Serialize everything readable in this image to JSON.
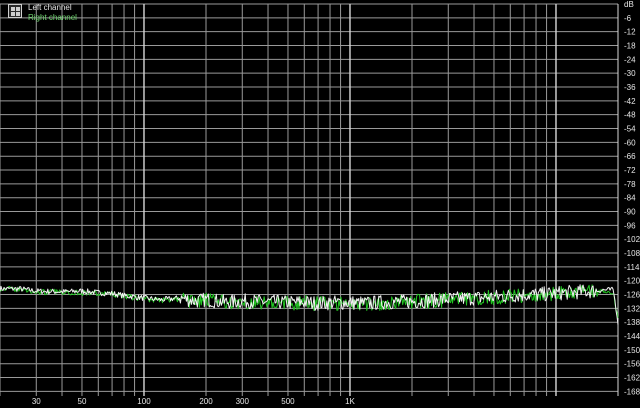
{
  "legend": {
    "left_label": "Left channel",
    "right_label": "Right channel",
    "icon": "grid-settings-icon"
  },
  "colors": {
    "background": "#000000",
    "grid_minor": "#9a9a9a",
    "grid_major": "#d8d8d8",
    "axis_text": "#e6e6e6",
    "left_channel": "#f2f2f2",
    "right_channel": "#22c722"
  },
  "chart_data": {
    "type": "line",
    "title": "",
    "xlabel": "",
    "ylabel": "dB",
    "x_scale": "log",
    "xlim": [
      20,
      20000
    ],
    "ylim": [
      -170,
      0
    ],
    "grid": true,
    "legend_placement": "top-left",
    "x_ticks": [
      {
        "value": 30,
        "label": "30"
      },
      {
        "value": 50,
        "label": "50"
      },
      {
        "value": 100,
        "label": "100"
      },
      {
        "value": 200,
        "label": "200"
      },
      {
        "value": 300,
        "label": "300"
      },
      {
        "value": 500,
        "label": "500"
      },
      {
        "value": 1000,
        "label": "1K"
      }
    ],
    "y_ticks": [
      0,
      -6,
      -12,
      -18,
      -24,
      -30,
      -36,
      -42,
      -48,
      -54,
      -60,
      -66,
      -72,
      -78,
      -84,
      -90,
      -96,
      -102,
      -108,
      -114,
      -120,
      -126,
      -132,
      -138,
      -144,
      -150,
      -156,
      -162,
      -168
    ],
    "y_tick_labels": [
      "dB",
      "-6",
      "-12",
      "-18",
      "-24",
      "-30",
      "-36",
      "-42",
      "-48",
      "-54",
      "-60",
      "-66",
      "-72",
      "-78",
      "-84",
      "-90",
      "-96",
      "-102",
      "-108",
      "-114",
      "-120",
      "-126",
      "-132",
      "-138",
      "-144",
      "-150",
      "-156",
      "-162",
      "-168"
    ],
    "x": [
      20,
      25,
      30,
      40,
      50,
      60,
      70,
      80,
      100,
      120,
      150,
      180,
      200,
      250,
      300,
      400,
      500,
      600,
      700,
      800,
      1000,
      1200,
      1500,
      2000,
      2500,
      3000,
      4000,
      5000,
      6000,
      7000,
      8000,
      10000,
      12000,
      15000,
      17000,
      19000,
      20000
    ],
    "series": [
      {
        "name": "Left channel",
        "values": [
          -123.5,
          -123.5,
          -124.5,
          -124.8,
          -124.5,
          -125.2,
          -125.5,
          -126.5,
          -127.5,
          -128.3,
          -127.5,
          -128.8,
          -128.2,
          -129.3,
          -128.8,
          -129.2,
          -129.5,
          -129.3,
          -129.8,
          -129.5,
          -129.5,
          -129.8,
          -129.3,
          -129,
          -128.5,
          -128,
          -127.5,
          -127,
          -126.5,
          -126,
          -126,
          -125.5,
          -125,
          -124.5,
          -124,
          -124,
          -138
        ]
      },
      {
        "name": "Right channel",
        "values": [
          -123.5,
          -123.8,
          -125,
          -124.8,
          -125.2,
          -125.5,
          -125.8,
          -126.8,
          -127.8,
          -128.5,
          -128,
          -129,
          -128.5,
          -129.5,
          -129,
          -129.5,
          -129.8,
          -129.5,
          -130,
          -129.8,
          -129.8,
          -130,
          -129.5,
          -129.2,
          -128.8,
          -128.2,
          -127.8,
          -127.2,
          -126.8,
          -126.3,
          -126.2,
          -125.8,
          -125.3,
          -124.8,
          -124.5,
          -125,
          -137
        ]
      }
    ]
  }
}
